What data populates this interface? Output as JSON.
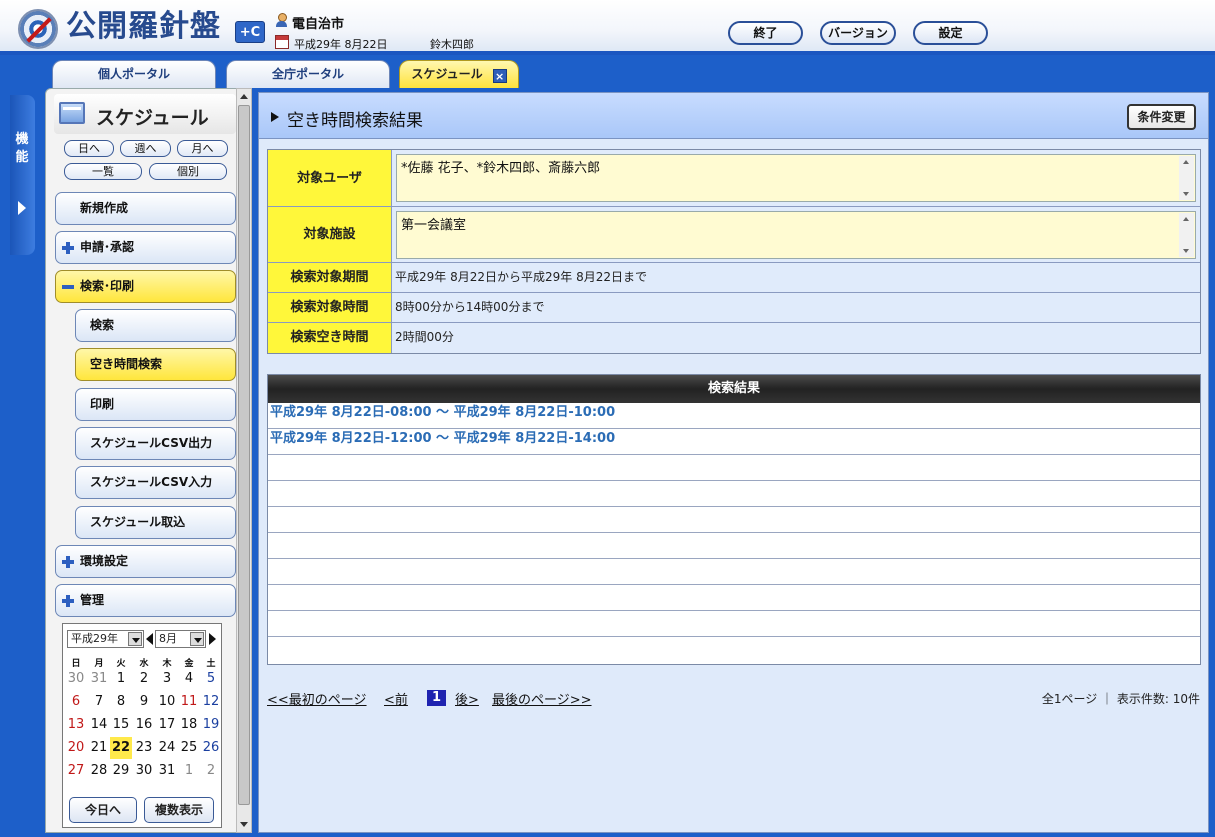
{
  "header": {
    "logo_text": "公開羅針盤",
    "logo_badge": "+C",
    "org": "電自治市",
    "date": "平成29年 8月22日",
    "user": "鈴木四郎",
    "buttons": {
      "exit": "終了",
      "version": "バージョン",
      "settings": "設定"
    }
  },
  "tabs": [
    {
      "label": "個人ポータル"
    },
    {
      "label": "全庁ポータル"
    },
    {
      "label": "スケジュール",
      "close": "×"
    }
  ],
  "rail": {
    "label": "機能"
  },
  "sidebar": {
    "title": "スケジュール",
    "view_buttons": {
      "day": "日へ",
      "week": "週へ",
      "month": "月へ",
      "list": "一覧",
      "individual": "個別"
    },
    "menu": {
      "new": "新規作成",
      "apply": "申請･承認",
      "search_print": "検索･印刷",
      "search": "検索",
      "free_time": "空き時間検索",
      "print": "印刷",
      "csv_out": "スケジュールCSV出力",
      "csv_in": "スケジュールCSV入力",
      "import": "スケジュール取込",
      "env": "環境設定",
      "admin": "管理"
    },
    "calendar": {
      "year": "平成29年",
      "month": "8月",
      "weekdays": [
        "日",
        "月",
        "火",
        "水",
        "木",
        "金",
        "土"
      ],
      "weeks": [
        [
          "30",
          "31",
          "1",
          "2",
          "3",
          "4",
          "5"
        ],
        [
          "6",
          "7",
          "8",
          "9",
          "10",
          "11",
          "12"
        ],
        [
          "13",
          "14",
          "15",
          "16",
          "17",
          "18",
          "19"
        ],
        [
          "20",
          "21",
          "22",
          "23",
          "24",
          "25",
          "26"
        ],
        [
          "27",
          "28",
          "29",
          "30",
          "31",
          "1",
          "2"
        ]
      ],
      "today_button": "今日へ",
      "multi_button": "複数表示"
    }
  },
  "main": {
    "title": "空き時間検索結果",
    "change_button": "条件変更",
    "conditions": {
      "target_user_label": "対象ユーザ",
      "target_user_value": "*佐藤 花子、*鈴木四郎、斎藤六郎",
      "target_facility_label": "対象施設",
      "target_facility_value": "第一会議室",
      "period_label": "検索対象期間",
      "period_value": "平成29年 8月22日から平成29年 8月22日まで",
      "time_label": "検索対象時間",
      "time_value": "8時00分から14時00分まで",
      "free_label": "検索空き時間",
      "free_value": "2時間00分"
    },
    "results_header": "検索結果",
    "results": [
      "平成29年 8月22日-08:00 〜 平成29年 8月22日-10:00",
      "平成29年 8月22日-12:00 〜 平成29年 8月22日-14:00"
    ],
    "pager": {
      "first": "<<最初のページ",
      "prev": "<前",
      "current": "1",
      "next": "後>",
      "last": "最後のページ>>"
    },
    "page_info": "全1ページ ｜ 表示件数: 10件"
  }
}
